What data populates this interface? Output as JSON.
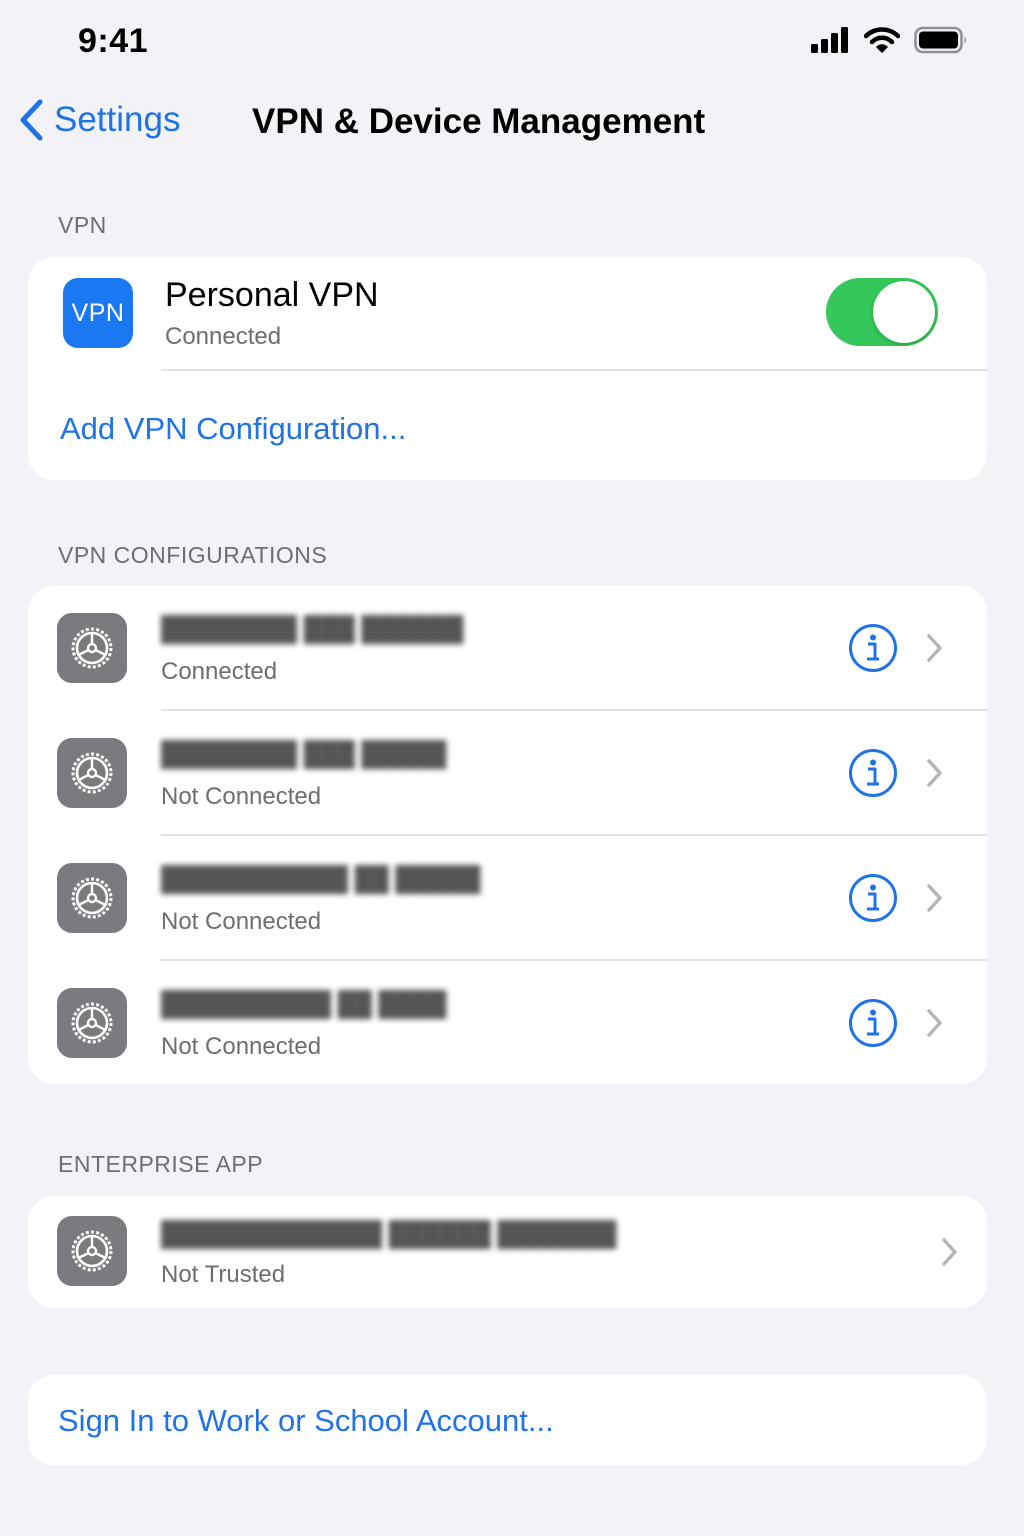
{
  "status_bar": {
    "time": "9:41",
    "icons": [
      "cellular-signal-icon",
      "wifi-icon",
      "battery-icon"
    ]
  },
  "nav": {
    "back_label": "Settings",
    "title": "VPN & Device Management"
  },
  "vpn_section": {
    "header": "VPN",
    "personal_vpn": {
      "icon_label": "VPN",
      "title": "Personal VPN",
      "status": "Connected",
      "toggle_on": true
    },
    "add_config_label": "Add VPN Configuration..."
  },
  "configs_section": {
    "header": "VPN CONFIGURATIONS",
    "items": [
      {
        "status": "Connected"
      },
      {
        "status": "Not Connected"
      },
      {
        "status": "Not Connected"
      },
      {
        "status": "Not Connected"
      }
    ]
  },
  "enterprise_section": {
    "header": "ENTERPRISE APP",
    "items": [
      {
        "status": "Not Trusted"
      }
    ]
  },
  "sign_in_label": "Sign In to Work or School Account...",
  "colors": {
    "accent": "#1f73e6",
    "toggle_on": "#34c759",
    "background": "#f2f2f7",
    "secondary_text": "#6d6d72"
  }
}
